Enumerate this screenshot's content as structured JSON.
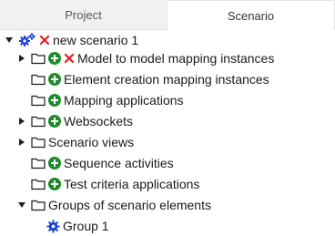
{
  "tabs": [
    {
      "label": "Project",
      "active": false
    },
    {
      "label": "Scenario",
      "active": true
    }
  ],
  "tree": {
    "root": {
      "label": "new scenario 1",
      "expanded": true
    },
    "items": [
      {
        "label": "Model to model mapping instances",
        "expandable": true,
        "expanded": false,
        "icons": [
          "folder-icon",
          "add-icon",
          "remove-icon"
        ]
      },
      {
        "label": "Element creation mapping instances",
        "expandable": false,
        "icons": [
          "folder-icon",
          "add-icon"
        ]
      },
      {
        "label": "Mapping applications",
        "expandable": false,
        "icons": [
          "folder-icon",
          "add-icon"
        ]
      },
      {
        "label": "Websockets",
        "expandable": true,
        "expanded": false,
        "icons": [
          "folder-icon",
          "add-icon"
        ]
      },
      {
        "label": "Scenario views",
        "expandable": true,
        "expanded": false,
        "icons": [
          "folder-icon"
        ]
      },
      {
        "label": "Sequence activities",
        "expandable": false,
        "icons": [
          "folder-icon",
          "add-icon"
        ]
      },
      {
        "label": "Test criteria applications",
        "expandable": false,
        "icons": [
          "folder-icon",
          "add-icon"
        ]
      },
      {
        "label": "Groups of scenario elements",
        "expandable": true,
        "expanded": true,
        "icons": [
          "folder-icon"
        ]
      },
      {
        "label": "Group 1",
        "icons": [
          "gear-icon"
        ]
      }
    ]
  },
  "colors": {
    "add": "#1f8a2c",
    "remove": "#e02020",
    "gear": "#1a3fd6",
    "folder": "#1a1a1a"
  }
}
